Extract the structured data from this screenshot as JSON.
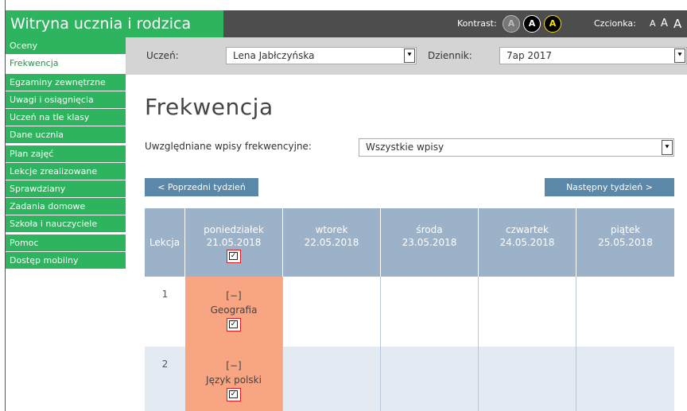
{
  "app": {
    "title": "Witryna ucznia i rodzica",
    "kontrast_label": "Kontrast:",
    "kontrast_options": [
      "A",
      "A",
      "A"
    ],
    "czcionka_label": "Czcionka:",
    "font_sizes": [
      "A",
      "A",
      "A"
    ]
  },
  "sidebar": {
    "items": [
      {
        "label": "Oceny"
      },
      {
        "label": "Frekwencja",
        "active": true
      },
      {
        "label": "Egzaminy zewnętrzne"
      },
      {
        "label": "Uwagi i osiągnięcia"
      },
      {
        "label": "Uczeń na tle klasy"
      },
      {
        "label": "Dane ucznia"
      },
      {
        "label": "Plan zajęć"
      },
      {
        "label": "Lekcje zrealizowane"
      },
      {
        "label": "Sprawdziany"
      },
      {
        "label": "Zadania domowe"
      },
      {
        "label": "Szkoła i nauczyciele"
      },
      {
        "label": "Pomoc"
      },
      {
        "label": "Dostęp mobilny"
      }
    ]
  },
  "student_bar": {
    "uczen_label": "Uczeń:",
    "uczen_value": "Lena Jabłczyńska",
    "dziennik_label": "Dziennik:",
    "dziennik_value": "7ap 2017",
    "arrow": "⯆"
  },
  "main": {
    "title": "Frekwencja",
    "filter_label": "Uwzględniane wpisy frekwencyjne:",
    "filter_value": "Wszystkie wpisy",
    "prev_week": "< Poprzedni tydzień",
    "next_week": "Następny tydzień >"
  },
  "table": {
    "lekcja_header": "Lekcja",
    "days": [
      {
        "name": "poniedziałek",
        "date": "21.05.2018",
        "checked": true
      },
      {
        "name": "wtorek",
        "date": "22.05.2018"
      },
      {
        "name": "środa",
        "date": "23.05.2018"
      },
      {
        "name": "czwartek",
        "date": "24.05.2018"
      },
      {
        "name": "piątek",
        "date": "25.05.2018"
      }
    ],
    "rows": [
      {
        "num": "1",
        "mark": "[−]",
        "subject": "Geografia",
        "checked": true
      },
      {
        "num": "2",
        "mark": "[−]",
        "subject": "Język polski",
        "checked": true
      }
    ],
    "check_glyph": "✓"
  },
  "colors": {
    "brand_green": "#2eb35f",
    "topbar_dark": "#4d4d4d",
    "header_blue": "#9bb2c9",
    "button_blue": "#5b87a8",
    "absent_salmon": "#f7a583",
    "row_alt": "#e3eaf2"
  }
}
